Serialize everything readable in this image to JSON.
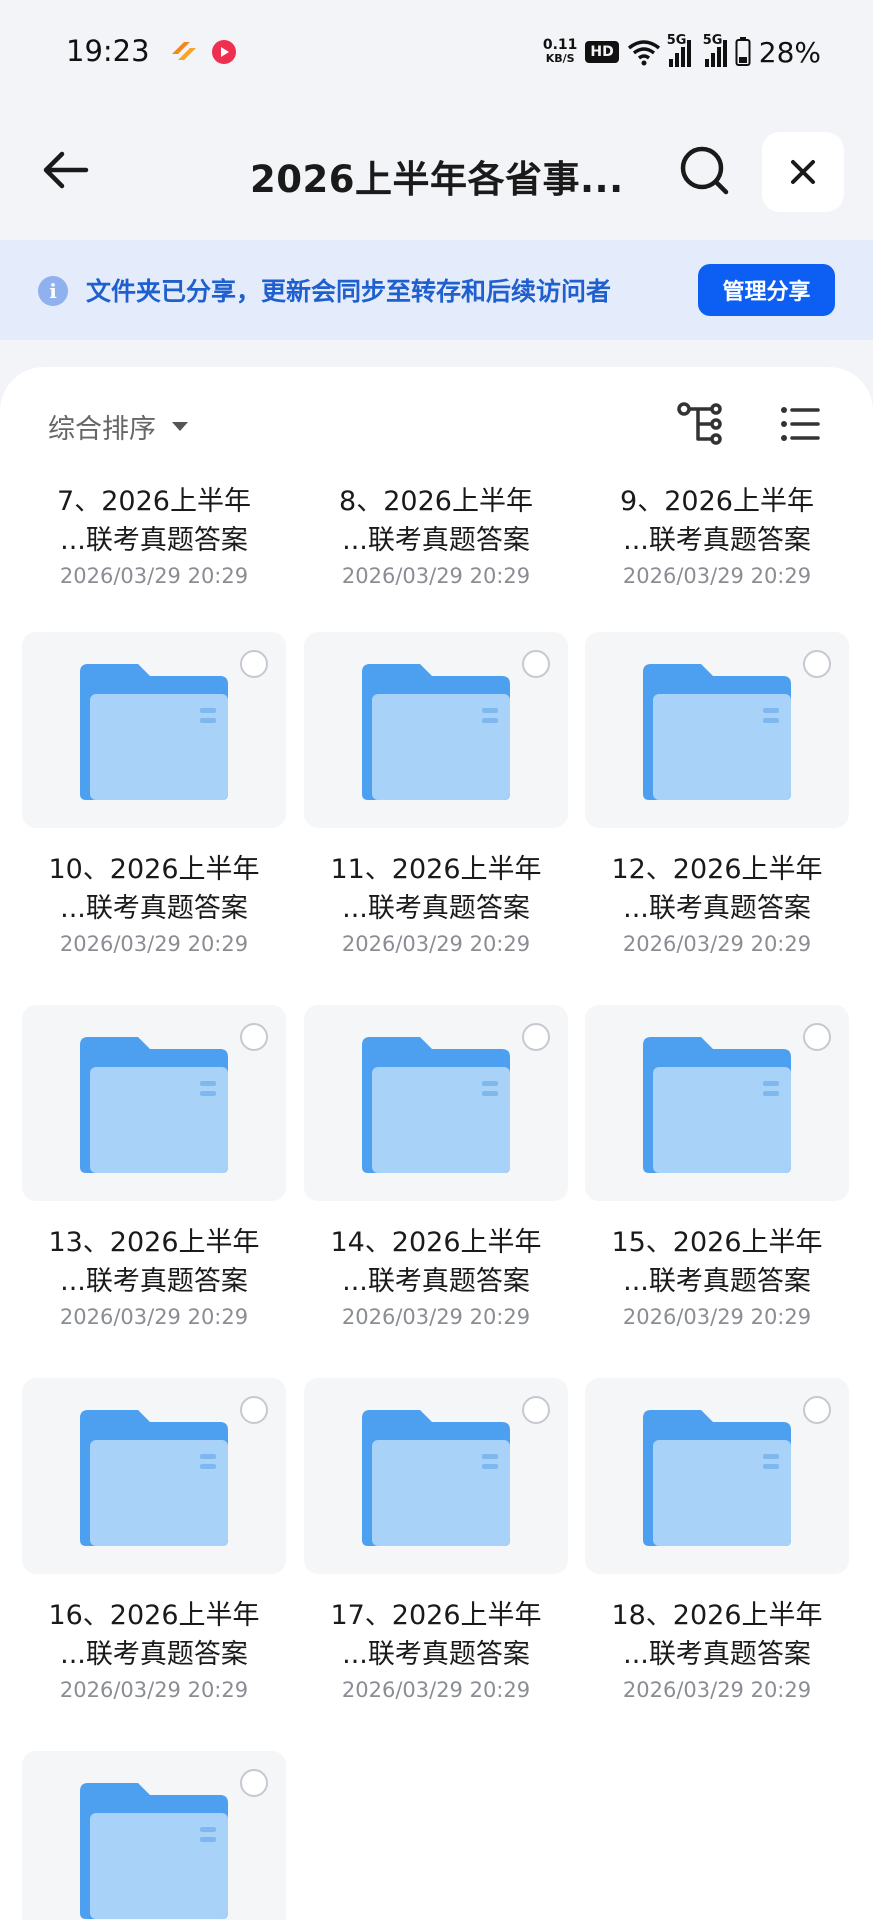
{
  "status_bar": {
    "time": "19:23",
    "speed_value": "0.11",
    "speed_unit": "KB/S",
    "hd_label": "HD",
    "signal_label_1": "5G",
    "signal_label_2": "5G",
    "battery": "28%"
  },
  "header": {
    "title": "2026上半年各省事..."
  },
  "banner": {
    "info_glyph": "i",
    "text": "文件夹已分享，更新会同步至转存和后续访问者",
    "manage_button": "管理分享"
  },
  "toolbar": {
    "sort_label": "综合排序"
  },
  "colors": {
    "accent": "#0c5ff2",
    "banner_bg": "#e4ecfb",
    "banner_text": "#1f5fce",
    "folder": "#66acef"
  },
  "top_row": [
    {
      "line1": "7、2026上半年",
      "line2": "...联考真题答案",
      "date": "2026/03/29 20:29"
    },
    {
      "line1": "8、2026上半年",
      "line2": "...联考真题答案",
      "date": "2026/03/29 20:29"
    },
    {
      "line1": "9、2026上半年",
      "line2": "...联考真题答案",
      "date": "2026/03/29 20:29"
    }
  ],
  "folders": [
    {
      "line1": "10、2026上半年",
      "line2": "...联考真题答案",
      "date": "2026/03/29 20:29"
    },
    {
      "line1": "11、2026上半年",
      "line2": "...联考真题答案",
      "date": "2026/03/29 20:29"
    },
    {
      "line1": "12、2026上半年",
      "line2": "...联考真题答案",
      "date": "2026/03/29 20:29"
    },
    {
      "line1": "13、2026上半年",
      "line2": "...联考真题答案",
      "date": "2026/03/29 20:29"
    },
    {
      "line1": "14、2026上半年",
      "line2": "...联考真题答案",
      "date": "2026/03/29 20:29"
    },
    {
      "line1": "15、2026上半年",
      "line2": "...联考真题答案",
      "date": "2026/03/29 20:29"
    },
    {
      "line1": "16、2026上半年",
      "line2": "...联考真题答案",
      "date": "2026/03/29 20:29"
    },
    {
      "line1": "17、2026上半年",
      "line2": "...联考真题答案",
      "date": "2026/03/29 20:29"
    },
    {
      "line1": "18、2026上半年",
      "line2": "...联考真题答案",
      "date": "2026/03/29 20:29"
    }
  ]
}
